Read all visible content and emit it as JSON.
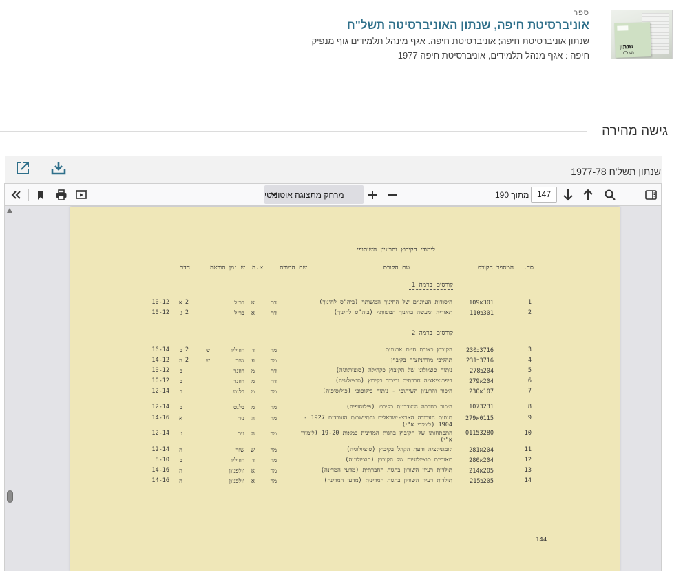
{
  "record": {
    "type_label": "ספר",
    "title": "אוניברסיטת חיפה, שנתון האוניברסיטה תשל\"ח",
    "line1": "שנתון אוניברסיטת חיפה; אוניברסיטת חיפה. אגף מינהל תלמידים גוף מנפיק",
    "line2": "חיפה : אגף מנהל תלמידים, אוניברסיטת חיפה 1977",
    "thumbnail_text_1": "שנתון",
    "thumbnail_text_2": "תשל\"ח"
  },
  "quick_access": {
    "title": "גישה מהירה"
  },
  "document": {
    "name": "שנתון תשל'ח 1977-78",
    "download_icon": "download-tray-icon",
    "external_icon": "open-external-icon"
  },
  "viewer": {
    "current_page": "147",
    "page_of": "מתוך 190",
    "zoom_value": "מרחק מתצוגה אוטומטי",
    "tool_icons": [
      "sidebar-toggle-icon",
      "search-icon",
      "arrow-up-icon",
      "arrow-down-icon",
      "zoom-out-icon",
      "zoom-in-icon",
      "presentation-icon",
      "print-icon",
      "bookmark-icon",
      "double-chevron-icon"
    ]
  },
  "pdf_page": {
    "heading": "לימודי הקיבוץ והרעיון השיתופי",
    "columns": {
      "num": "סד.",
      "code": "המספר הקורס",
      "course": "שם הקורס",
      "teacher": "שם המורה",
      "ah": "א.ה",
      "sh": "ש",
      "time": "זמן הוראה",
      "room": "חדר"
    },
    "section1": "קורסים ברמה 1",
    "section2": "קורסים ברמה 2",
    "rows": [
      {
        "num": "1",
        "code": "301א109",
        "course": "היסודות העיוניים של החינוך המשותף (ביה\"ס לחינוך)",
        "title": "דר",
        "init": "א",
        "teacher": "ברזל",
        "ah": "2",
        "sh": "",
        "day": "א",
        "hours": "10-12"
      },
      {
        "num": "2",
        "code": "301ב110",
        "course": "תאוריה ומעשה בחינוך המשותף (ביה\"ס לחינוך)",
        "title": "דר",
        "init": "א",
        "teacher": "ברזל",
        "ah": "2",
        "sh": "",
        "day": "ג",
        "hours": "10-12"
      },
      {
        "num": "3",
        "code": "3716ב230",
        "course": "הקיבוץ כצורת חיים ארגונית",
        "title": "מר",
        "init": "ד",
        "teacher": "רוזוליו",
        "ah": "2",
        "sh": "ש",
        "day": "ב",
        "hours": "16-14"
      },
      {
        "num": "4",
        "code": "3716ב231",
        "course": "תהליכי מודרניזציה בקיבוץ",
        "title": "מר",
        "init": "ע",
        "teacher": "שור",
        "ah": "2",
        "sh": "ש",
        "day": "ה",
        "hours": "14-12"
      },
      {
        "num": "5",
        "code": "204ב278",
        "course": "ניתוח סוציולוגי של הקיבוץ כקהילה (סוציולוגיה)",
        "title": "דר",
        "init": "מ",
        "teacher": "רוזנר",
        "ah": "",
        "sh": "",
        "day": "ב",
        "hours": "10-12"
      },
      {
        "num": "6",
        "code": "204א279",
        "course": "דיפרנציאציה חברתית וריבוד בקיבוץ (סוציולוגיה)",
        "title": "דר",
        "init": "מ",
        "teacher": "רוזנר",
        "ah": "",
        "sh": "",
        "day": "ב",
        "hours": "10-12"
      },
      {
        "num": "7",
        "code": "107א230",
        "course": "היכור והרעיון השיתופי - ניתוח פילוסופי (פילוסופיה)",
        "title": "מר",
        "init": "מ",
        "teacher": "בלנט",
        "ah": "",
        "sh": "",
        "day": "ב",
        "hours": "12-14"
      },
      {
        "num": "8",
        "code": "1073231",
        "course": "היכור בחברה המודרנית בקיבוץ (פילוסופיה)",
        "title": "מר",
        "init": "מ",
        "teacher": "בלנט",
        "ah": "",
        "sh": "",
        "day": "ב",
        "hours": "12-14"
      },
      {
        "num": "9",
        "code": "0115א279",
        "course": "תנועת העבודה הארצ-ישראלית והתיישבות העובדים 1927 - 1904 (לימודי א\"י)",
        "title": "מר",
        "init": "ה",
        "teacher": "ניר",
        "ah": "",
        "sh": "",
        "day": "א",
        "hours": "14-16"
      },
      {
        "num": "10",
        "code": "01153280",
        "course": "התפתחותו של הקיבוץ בהגות המדינית במאות 19-20 (לימודי א\"י)",
        "title": "מר",
        "init": "ה",
        "teacher": "ניר",
        "ah": "",
        "sh": "",
        "day": "ג",
        "hours": "12-14"
      },
      {
        "num": "11",
        "code": "204א281",
        "course": "קומוניקציה ודעת הקהל בקיבוץ (סוציולוגיה)",
        "title": "מר",
        "init": "ש",
        "teacher": "שור",
        "ah": "",
        "sh": "",
        "day": "ה",
        "hours": "12-14"
      },
      {
        "num": "12",
        "code": "204א280",
        "course": "תאוריות סוציולוגיות של הקיבוץ (סוציולוגיה)",
        "title": "מר",
        "init": "ד",
        "teacher": "רוזוליו",
        "ah": "",
        "sh": "",
        "day": "ב",
        "hours": "8-10"
      },
      {
        "num": "13",
        "code": "205א214",
        "course": "תולדות רעיון השוויון בהגות החברתית (מדעי המדינה)",
        "title": "מר",
        "init": "א",
        "teacher": "וולפנזון",
        "ah": "",
        "sh": "",
        "day": "ה",
        "hours": "14-16"
      },
      {
        "num": "14",
        "code": "205ב215",
        "course": "תולדות רעיון השוויון בהגות המדינית (מדעי המדינה)",
        "title": "מר",
        "init": "א",
        "teacher": "וולפנזון",
        "ah": "",
        "sh": "",
        "day": "ה",
        "hours": "14-16"
      }
    ],
    "page_number": "144"
  }
}
